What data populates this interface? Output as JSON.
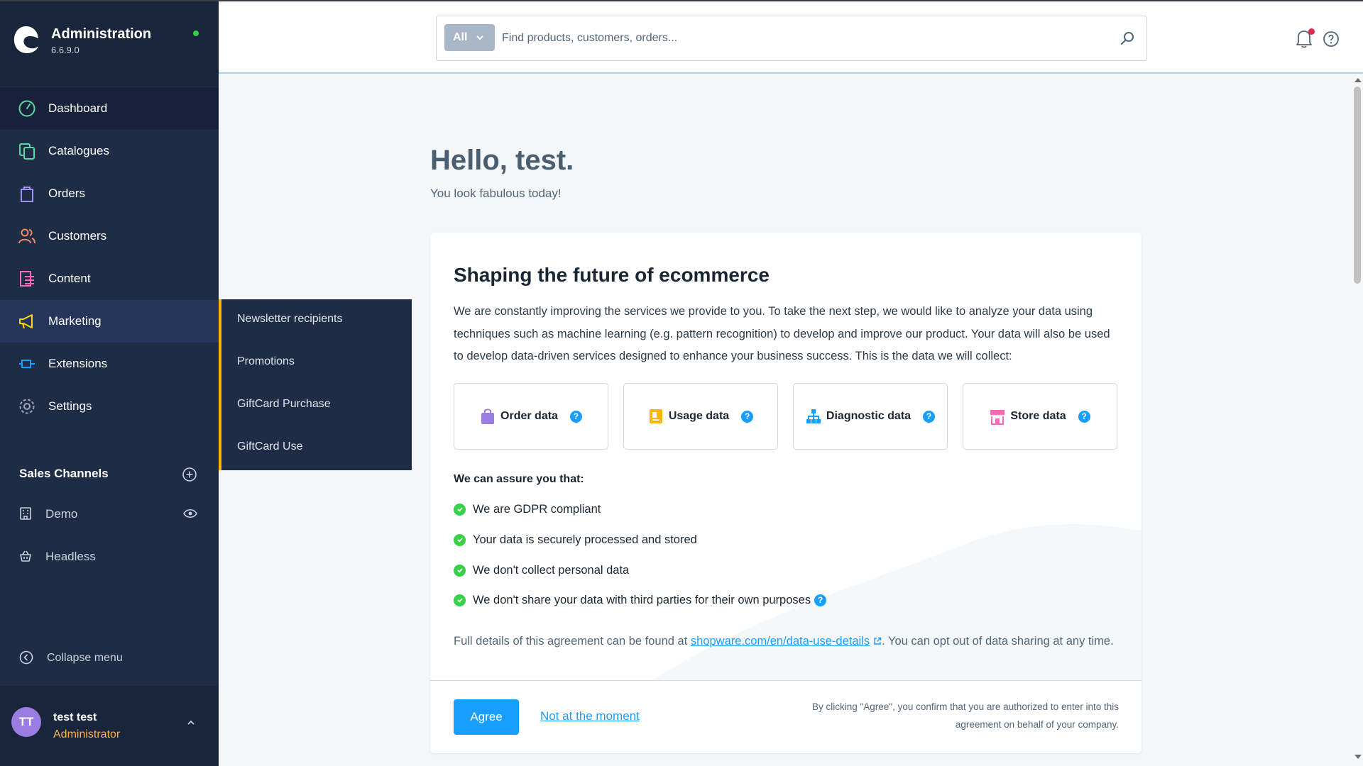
{
  "app": {
    "title": "Administration",
    "version": "6.6.9.0"
  },
  "sidebar": {
    "items": [
      {
        "label": "Dashboard",
        "icon": "dashboard-icon",
        "color": "#57d9a3"
      },
      {
        "label": "Catalogues",
        "icon": "catalogue-icon",
        "color": "#57d9a3"
      },
      {
        "label": "Orders",
        "icon": "orders-icon",
        "color": "#a092f0"
      },
      {
        "label": "Customers",
        "icon": "customers-icon",
        "color": "#f88962"
      },
      {
        "label": "Content",
        "icon": "content-icon",
        "color": "#ff68b4"
      },
      {
        "label": "Marketing",
        "icon": "marketing-icon",
        "color": "#ffd700"
      },
      {
        "label": "Extensions",
        "icon": "extensions-icon",
        "color": "#189eff"
      },
      {
        "label": "Settings",
        "icon": "settings-icon",
        "color": "#9aa8b5"
      }
    ],
    "sales_channels_title": "Sales Channels",
    "channels": [
      {
        "label": "Demo",
        "icon": "storefront-icon"
      },
      {
        "label": "Headless",
        "icon": "basket-icon"
      }
    ],
    "collapse_label": "Collapse menu",
    "user": {
      "initials": "TT",
      "name": "test test",
      "role": "Administrator"
    }
  },
  "flyout": {
    "items": [
      "Newsletter recipients",
      "Promotions",
      "GiftCard Purchase",
      "GiftCard Use"
    ]
  },
  "search": {
    "type_label": "All",
    "placeholder": "Find products, customers, orders..."
  },
  "greeting": {
    "title": "Hello, test.",
    "subtitle": "You look fabulous today!"
  },
  "consent": {
    "title": "Shaping the future of ecommerce",
    "description": "We are constantly improving the services we provide to you. To take the next step, we would like to analyze your data using techniques such as machine learning (e.g. pattern recognition) to develop and improve our product. Your data will also be used to develop data-driven services designed to enhance your business success. This is the data we will collect:",
    "tiles": [
      {
        "label": "Order data",
        "icon": "shopping-bag-icon",
        "color": "#9a7de0"
      },
      {
        "label": "Usage data",
        "icon": "usage-icon",
        "color": "#ffb600"
      },
      {
        "label": "Diagnostic data",
        "icon": "sitemap-icon",
        "color": "#189eff"
      },
      {
        "label": "Store data",
        "icon": "store-icon",
        "color": "#ff68b4"
      }
    ],
    "assure_title": "We can assure you that:",
    "assurances": [
      "We are GDPR compliant",
      "Your data is securely processed and stored",
      "We don't collect personal data",
      "We don't share your data with third parties for their own purposes"
    ],
    "details_prefix": "Full details of this agreement can be found at ",
    "details_link": "shopware.com/en/data-use-details",
    "details_suffix": ". You can opt out of data sharing at any time.",
    "agree_label": "Agree",
    "decline_label": "Not at the moment",
    "confirm_text": "By clicking \"Agree\", you confirm that you are authorized to enter into this agreement on behalf of your company."
  },
  "colors": {
    "sidebar_bg": "#1e2c46",
    "accent": "#189eff",
    "success": "#37d046",
    "marketing_bar": "#ffb600"
  }
}
